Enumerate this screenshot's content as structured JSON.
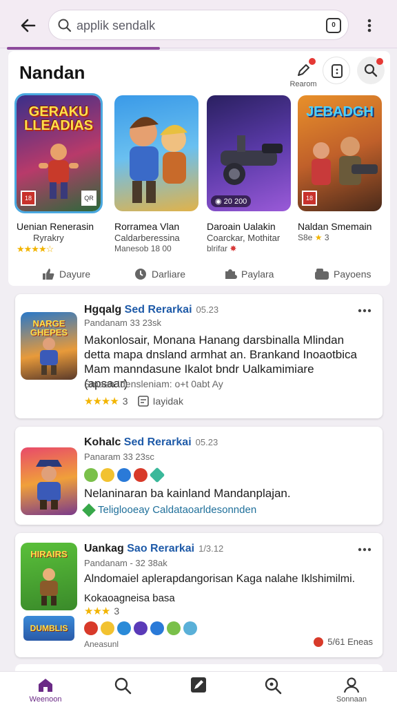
{
  "search": {
    "value": "applik sendalk"
  },
  "header": {
    "title": "Nandan",
    "action_label": "Rearom"
  },
  "featured": [
    {
      "art_title": "GERAKU LLEADIAS",
      "name": "Uenian Renerasin",
      "sub": "Ryrakry",
      "art_colors": [
        "#2a2f7a",
        "#d8342c"
      ]
    },
    {
      "art_title": "",
      "name": "Rorramea Vlan",
      "sub": "Caldarberessina",
      "meta": "Manesob 18 00",
      "art_colors": [
        "#3a8fd8",
        "#e9b53a"
      ]
    },
    {
      "art_title": "",
      "name": "Daroain Ualakin",
      "sub": "Coarckar, Mothitar",
      "meta": "blrifar",
      "price": "20 200",
      "art_colors": [
        "#3b2a6e",
        "#8a4fc8"
      ]
    },
    {
      "art_title": "JEBADGH",
      "name": "Naldan Smemain",
      "sub": "",
      "meta": "S8e",
      "meta_num": "3",
      "art_colors": [
        "#d9762a",
        "#5a3c2a"
      ]
    }
  ],
  "categories": [
    {
      "label": "Dayure",
      "icon": "thumbs-up-icon"
    },
    {
      "label": "Darliare",
      "icon": "clock-icon"
    },
    {
      "label": "Paylara",
      "icon": "puzzle-icon"
    },
    {
      "label": "Payoens",
      "icon": "controller-icon"
    }
  ],
  "cards": [
    {
      "thumb_title": "NARGE GHEPES",
      "title_a": "Hgqalg",
      "title_b": "Sed Rerarkai",
      "date": "05.23",
      "sub": "Pandanam  33 23sk",
      "body": "Makonlosair, Monana Hanang darsbinalla Mlindan detta mapa dnsland armhat an. Brankand Inoaotbica Mam manndasune Ikalot bndr Ualkamimiare (apsaar)",
      "extra": "Smaen  Idensleniam: o+t 0abt Ay",
      "rating": "3",
      "action": "Iayidak"
    },
    {
      "thumb_title": "",
      "title_a": "Kohalc",
      "title_b": "Sed Rerarkai",
      "date": "05.23",
      "sub": "Panaram  33 23sc",
      "body": "Nelaninaran ba kainland Mandanplajan.",
      "link": "Teliglooeay Caldataoarldesonnden"
    },
    {
      "thumb_title": "HIRAIRS",
      "thumb_badge": "DUMBLIS",
      "title_a": "Uankag",
      "title_b": "Sao Rerarkai",
      "date": "1/3.12",
      "sub": "Pandanam - 32 38ak",
      "body": "Alndomaiel aplerapdangorisan Kaga nalahe Iklshimilmi.",
      "extra": "Kokaoagneisa basa",
      "rating": "3",
      "foot": "Aneasunl",
      "foot_right": "5/61 Eneas"
    }
  ],
  "nav": [
    {
      "label": "Weenoon",
      "icon": "home-icon",
      "active": true
    },
    {
      "label": "",
      "icon": "search-icon"
    },
    {
      "label": "",
      "icon": "edit-icon"
    },
    {
      "label": "",
      "icon": "discover-icon"
    },
    {
      "label": "Sonnaan",
      "icon": "profile-icon"
    }
  ],
  "colors": {
    "accent": "#6a2a86",
    "link": "#1e5aa8",
    "star": "#f2b400"
  }
}
